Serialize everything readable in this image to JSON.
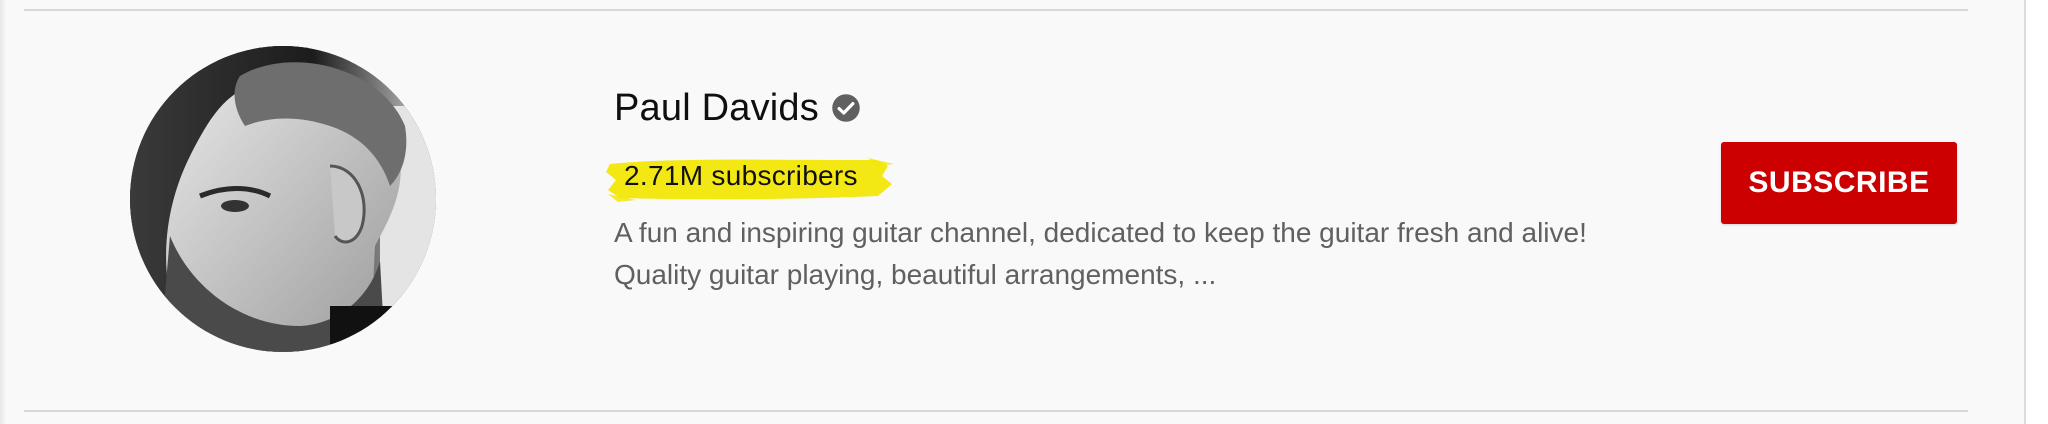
{
  "channel": {
    "name": "Paul Davids",
    "verified": true,
    "subscriber_count": "2.71M subscribers",
    "description_lines": [
      "A fun and inspiring guitar channel, dedicated to keep the guitar fresh and alive!",
      "Quality guitar playing, beautiful arrangements, ..."
    ]
  },
  "actions": {
    "subscribe_label": "SUBSCRIBE"
  },
  "icons": {
    "verified": "check-circle-icon"
  },
  "colors": {
    "subscribe_bg": "#cc0000",
    "highlight": "#f2e600",
    "name_text": "#0f0f0f",
    "description_text": "#606060"
  }
}
